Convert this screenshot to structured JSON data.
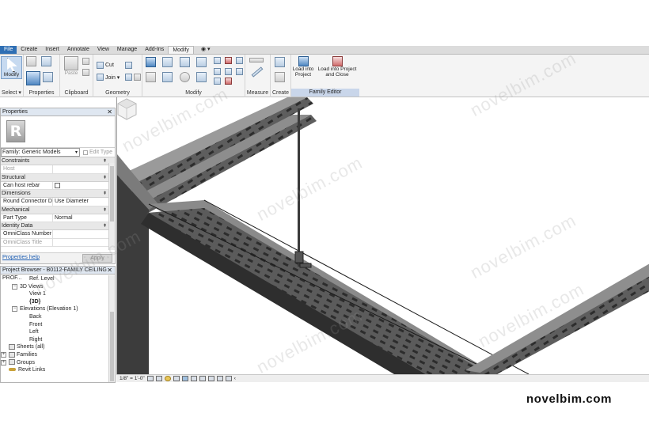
{
  "ribbon": {
    "tabs": [
      {
        "label": "File",
        "style": "file"
      },
      {
        "label": "Create",
        "style": ""
      },
      {
        "label": "Insert",
        "style": ""
      },
      {
        "label": "Annotate",
        "style": ""
      },
      {
        "label": "View",
        "style": ""
      },
      {
        "label": "Manage",
        "style": ""
      },
      {
        "label": "Add-Ins",
        "style": ""
      },
      {
        "label": "Modify",
        "style": "active"
      },
      {
        "label": "◉ ▾",
        "style": "extra"
      }
    ],
    "modify_label": "Modify",
    "select_label": "Select ▾",
    "properties_label": "Properties",
    "clipboard_label": "Clipboard",
    "paste_label": "Paste",
    "cut_label": "Cut",
    "join_label": "Join ▾",
    "geometry_label": "Geometry",
    "modify_panel_label": "Modify",
    "measure_label": "Measure",
    "create_label": "Create",
    "load_into_project_label": "Load into Project",
    "load_into_project_close_label": "Load into Project and Close",
    "family_editor_label": "Family Editor"
  },
  "properties": {
    "title": "Properties",
    "family_value": "Family: Generic Models",
    "edit_type_label": "Edit Type",
    "groups": [
      {
        "label": "Constraints",
        "rows": [
          {
            "k": "Host",
            "v": "",
            "dim": true
          }
        ]
      },
      {
        "label": "Structural",
        "rows": [
          {
            "k": "Can host rebar",
            "v": "",
            "checkbox": true
          }
        ]
      },
      {
        "label": "Dimensions",
        "rows": [
          {
            "k": "Round Connector D...",
            "v": "Use Diameter"
          }
        ]
      },
      {
        "label": "Mechanical",
        "rows": [
          {
            "k": "Part Type",
            "v": "Normal"
          }
        ]
      },
      {
        "label": "Identity Data",
        "rows": [
          {
            "k": "OmniClass Number",
            "v": ""
          },
          {
            "k": "OmniClass Title",
            "v": "",
            "dim": true
          }
        ]
      }
    ],
    "help_link": "Properties help",
    "apply_label": "Apply"
  },
  "project_browser": {
    "title": "Project Browser - B0112-FAMILY CEILING PROF...",
    "items": [
      {
        "label": "Ref. Level",
        "indent": 36,
        "toggle": "",
        "icon": "",
        "bold": false
      },
      {
        "label": "3D Views",
        "indent": 24,
        "toggle": "−",
        "icon": "",
        "bold": false
      },
      {
        "label": "View 1",
        "indent": 36,
        "toggle": "",
        "icon": "",
        "bold": false
      },
      {
        "label": "{3D}",
        "indent": 36,
        "toggle": "",
        "icon": "",
        "bold": true
      },
      {
        "label": "Elevations (Elevation 1)",
        "indent": 24,
        "toggle": "−",
        "icon": "",
        "bold": false
      },
      {
        "label": "Back",
        "indent": 36,
        "toggle": "",
        "icon": "",
        "bold": false
      },
      {
        "label": "Front",
        "indent": 36,
        "toggle": "",
        "icon": "",
        "bold": false
      },
      {
        "label": "Left",
        "indent": 36,
        "toggle": "",
        "icon": "",
        "bold": false
      },
      {
        "label": "Right",
        "indent": 36,
        "toggle": "",
        "icon": "",
        "bold": false
      },
      {
        "label": "Sheets (all)",
        "indent": 10,
        "toggle": "",
        "icon": "sheet",
        "bold": false
      },
      {
        "label": "Families",
        "indent": 10,
        "toggle": "+",
        "icon": "sheet",
        "bold": false
      },
      {
        "label": "Groups",
        "indent": 10,
        "toggle": "+",
        "icon": "sheet",
        "bold": false
      },
      {
        "label": "Revit Links",
        "indent": 10,
        "toggle": "",
        "icon": "link",
        "bold": false
      }
    ]
  },
  "view": {
    "scale_label": "1/8\" = 1'-0\""
  },
  "watermark": "novelbim.com",
  "brand": "novelbim.com"
}
